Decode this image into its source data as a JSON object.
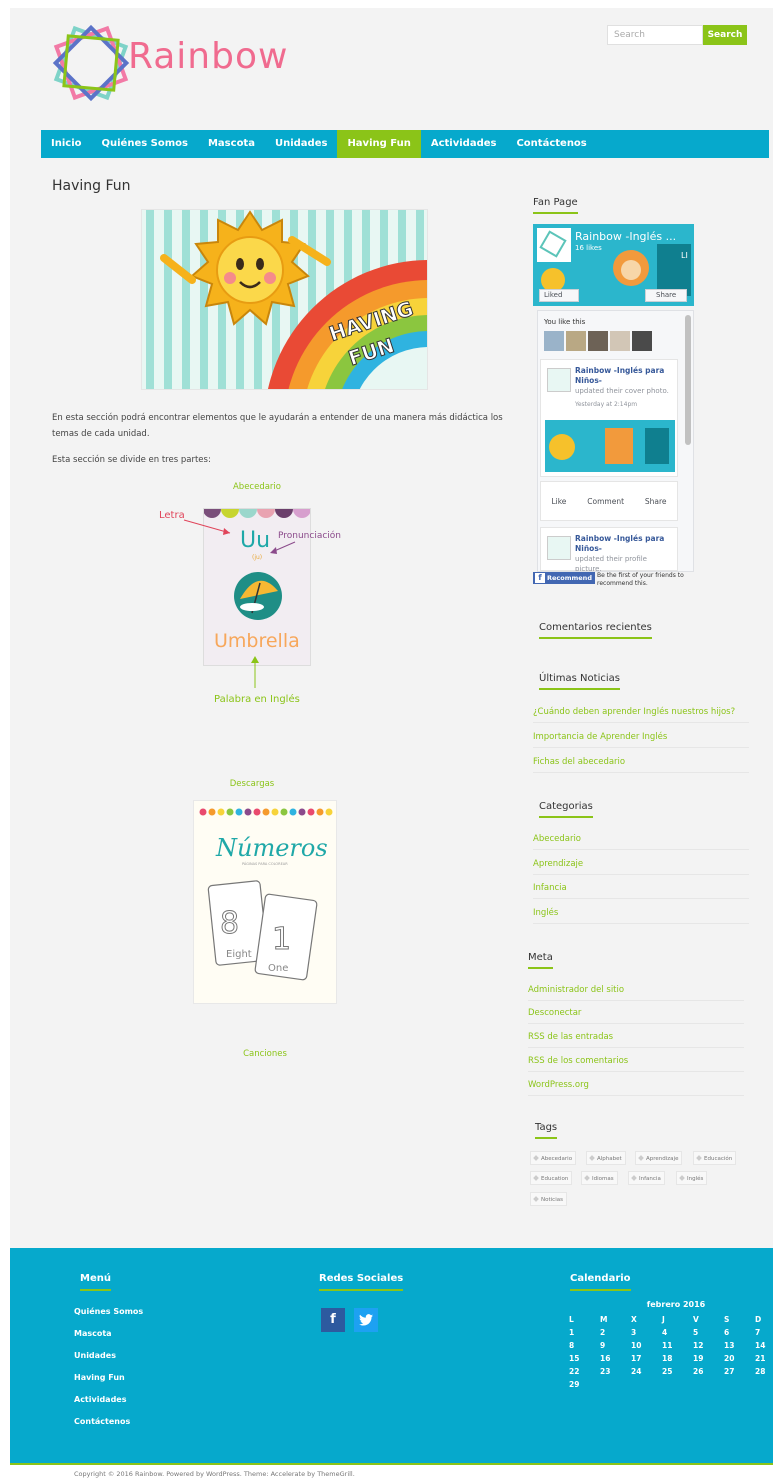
{
  "header": {
    "logo_text": "Rainbow",
    "search_placeholder": "Search",
    "search_button": "Search"
  },
  "nav": [
    {
      "label": "Inicio",
      "active": false
    },
    {
      "label": "Quiénes Somos",
      "active": false
    },
    {
      "label": "Mascota",
      "active": false
    },
    {
      "label": "Unidades",
      "active": false
    },
    {
      "label": "Having Fun",
      "active": true
    },
    {
      "label": "Actividades",
      "active": false
    },
    {
      "label": "Contáctenos",
      "active": false
    }
  ],
  "main": {
    "title": "Having Fun",
    "hero_text": [
      "HAVING",
      "FUN"
    ],
    "intro": "En esta sección podrá encontrar elementos que le ayudarán a entender de una manera más didáctica los temas de cada unidad.",
    "parts_intro": "Esta sección se divide en tres partes:",
    "section1": {
      "title": "Abecedario",
      "label_letra": "Letra",
      "label_pronunciacion": "Pronunciación",
      "label_palabra": "Palabra en Inglés",
      "card_letter": "Uu",
      "card_phonetic": "(ju)",
      "card_word": "Umbrella"
    },
    "section2": {
      "title": "Descargas",
      "card_title": "Números",
      "card_subtitle": "PÁGINAS PARA COLOREAR",
      "card_eight": "Eight",
      "card_one": "One"
    },
    "section3": {
      "title": "Canciones"
    }
  },
  "sidebar": {
    "fan_page_title": "Fan Page",
    "fb": {
      "page_name": "Rainbow -Inglés ...",
      "likes": "16 likes",
      "liked_button": "Liked",
      "share_button": "Share",
      "you_like_this": "You like this",
      "post1_name": "Rainbow -Inglés para Niños-",
      "post1_text": "updated their cover photo.",
      "post1_time": "Yesterday at 2:14pm",
      "action_like": "Like",
      "action_comment": "Comment",
      "action_share": "Share",
      "post2_name": "Rainbow -Inglés para Niños-",
      "post2_text": "updated their profile picture.",
      "recommend_button": "Recommend",
      "recommend_text": "Be the first of your friends to recommend this."
    },
    "recent_comments_title": "Comentarios recientes",
    "news_title": "Últimas Noticias",
    "news": [
      "¿Cuándo deben aprender Inglés nuestros hijos?",
      "Importancia de Aprender Inglés",
      "Fichas del abecedario"
    ],
    "categories_title": "Categorias",
    "categories": [
      "Abecedario",
      "Aprendizaje",
      "Infancia",
      "Inglés"
    ],
    "meta_title": "Meta",
    "meta": [
      "Administrador del sitio",
      "Desconectar",
      "RSS de las entradas",
      "RSS de los comentarios",
      "WordPress.org"
    ],
    "tags_title": "Tags",
    "tags": [
      "Abecedario",
      "Alphabet",
      "Aprendizaje",
      "Educación",
      "Education",
      "Idiomas",
      "Infancia",
      "Inglés",
      "Noticias"
    ]
  },
  "footer": {
    "menu_title": "Menú",
    "menu": [
      "Quiénes Somos",
      "Mascota",
      "Unidades",
      "Having Fun",
      "Actividades",
      "Contáctenos"
    ],
    "social_title": "Redes Sociales",
    "social_facebook": "f",
    "calendar_title": "Calendario",
    "calendar_caption": "febrero 2016",
    "calendar_days": [
      "L",
      "M",
      "X",
      "J",
      "V",
      "S",
      "D"
    ],
    "calendar_cells": [
      "1",
      "2",
      "3",
      "4",
      "5",
      "6",
      "7",
      "8",
      "9",
      "10",
      "11",
      "12",
      "13",
      "14",
      "15",
      "16",
      "17",
      "18",
      "19",
      "20",
      "21",
      "22",
      "23",
      "24",
      "25",
      "26",
      "27",
      "28",
      "29"
    ],
    "copyright": "Copyright © 2016 Rainbow. Powered by WordPress. Theme: Accelerate by ThemeGrill."
  },
  "colors": {
    "accent_green": "#8bc418",
    "accent_blue": "#06a9cc",
    "page_bg": "#f3f3f3"
  }
}
